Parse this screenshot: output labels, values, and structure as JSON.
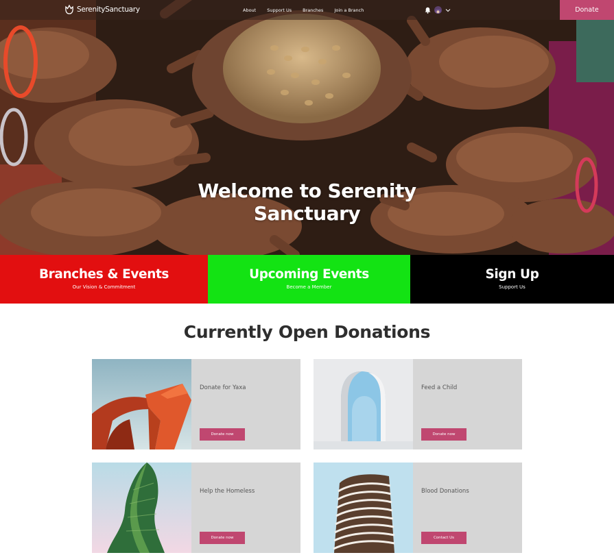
{
  "nav": {
    "brand": "SerenitySanctuary",
    "links": [
      "About",
      "Support Us",
      "Branches",
      "Join a Branch"
    ],
    "donate_label": "Donate",
    "accent": "#c04770"
  },
  "hero": {
    "title_line1": "Welcome to Serenity",
    "title_line2": "Sanctuary"
  },
  "tiles": [
    {
      "title": "Branches & Events",
      "subtitle": "Our Vision & Commitment",
      "color": "#e20f10"
    },
    {
      "title": "Upcoming Events",
      "subtitle": "Become a Member",
      "color": "#13e313"
    },
    {
      "title": "Sign Up",
      "subtitle": "Support Us",
      "color": "#000000"
    }
  ],
  "donations": {
    "title": "Currently Open Donations",
    "cards": [
      {
        "title": "Donate for Yaxa",
        "button": "Donate now"
      },
      {
        "title": "Feed a Child",
        "button": "Donate now"
      },
      {
        "title": "Help the Homeless",
        "button": "Donate now"
      },
      {
        "title": "Blood Donations",
        "button": "Contact Us"
      }
    ]
  }
}
